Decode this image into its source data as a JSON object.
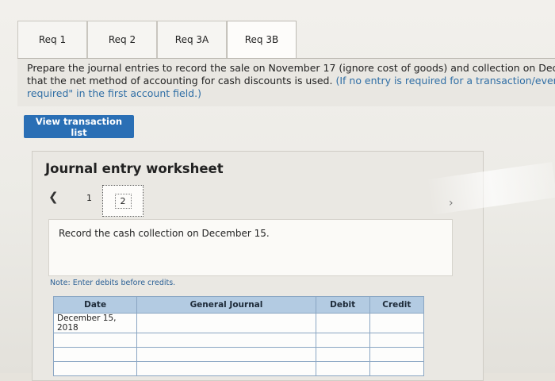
{
  "tabs": [
    {
      "label": "Req 1"
    },
    {
      "label": "Req 2"
    },
    {
      "label": "Req 3A"
    },
    {
      "label": "Req 3B"
    }
  ],
  "prompt": {
    "line1": "Prepare the journal entries to record the sale on November 17 (ignore cost of goods) and collection on December",
    "line2_a": "that the net method of accounting for cash discounts is used. ",
    "line2_b": "(If no entry is required for a transaction/event, selec",
    "line3": "required\" in the first account field.)"
  },
  "buttons": {
    "view_transactions": "View transaction list"
  },
  "worksheet": {
    "title": "Journal entry worksheet",
    "pages": [
      "1",
      "2"
    ],
    "current_page": "2",
    "instruction": "Record the cash collection on December 15.",
    "note": "Note: Enter debits before credits.",
    "columns": [
      "Date",
      "General Journal",
      "Debit",
      "Credit"
    ],
    "rows": [
      {
        "date": "December 15, 2018",
        "account": "",
        "debit": "",
        "credit": ""
      },
      {
        "date": "",
        "account": "",
        "debit": "",
        "credit": ""
      },
      {
        "date": "",
        "account": "",
        "debit": "",
        "credit": ""
      },
      {
        "date": "",
        "account": "",
        "debit": "",
        "credit": ""
      }
    ]
  }
}
